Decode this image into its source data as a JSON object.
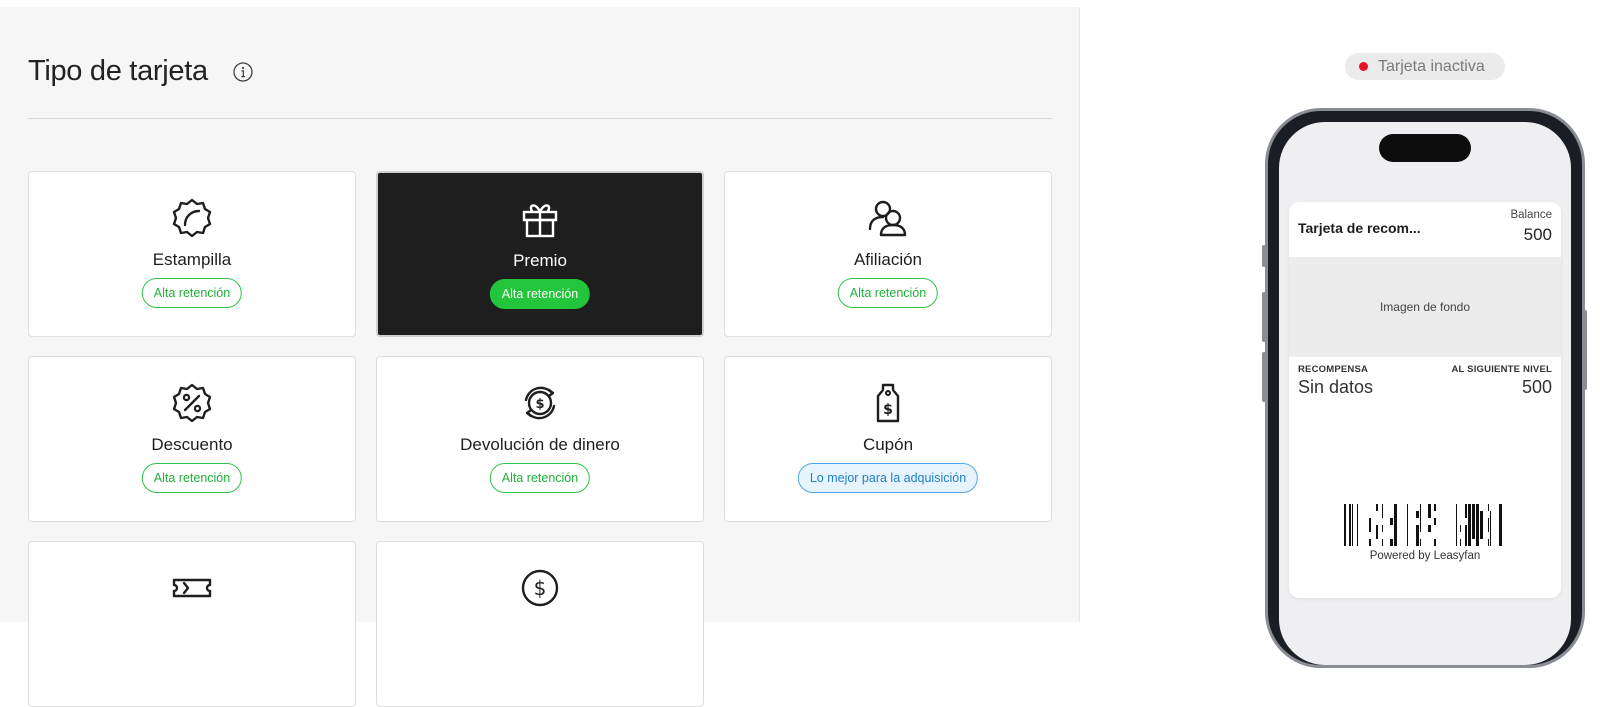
{
  "header": {
    "title": "Tipo de tarjeta"
  },
  "cards": [
    {
      "label": "Estampilla",
      "badge": "Alta retención",
      "icon": "stamp-icon",
      "selected": false
    },
    {
      "label": "Premio",
      "badge": "Alta retención",
      "icon": "gift-icon",
      "selected": true
    },
    {
      "label": "Afiliación",
      "badge": "Alta retención",
      "icon": "users-icon",
      "selected": false
    },
    {
      "label": "Descuento",
      "badge": "Alta retención",
      "icon": "discount-badge-icon",
      "selected": false
    },
    {
      "label": "Devolución de dinero",
      "badge": "Alta retención",
      "icon": "cashback-icon",
      "selected": false
    },
    {
      "label": "Cupón",
      "badge": "Lo mejor para la adquisición",
      "icon": "coupon-tag-icon",
      "selected": false
    },
    {
      "icon": "ticket-icon"
    },
    {
      "icon": "dollar-coin-icon"
    }
  ],
  "preview": {
    "status": "Tarjeta inactiva",
    "pass": {
      "title": "Tarjeta de recom...",
      "balance_label": "Balance",
      "balance_value": "500",
      "image_placeholder": "Imagen de fondo",
      "reward_label": "RECOMPENSA",
      "reward_value": "Sin datos",
      "next_level_label": "AL SIGUIENTE NIVEL",
      "next_level_value": "500",
      "powered_by": "Powered by Leasyfan"
    }
  },
  "colors": {
    "accent_green": "#22c53b",
    "selected_card": "#1e1e1e",
    "acquisition_blue": "#1f80c9",
    "inactive_red": "#e8102a"
  }
}
